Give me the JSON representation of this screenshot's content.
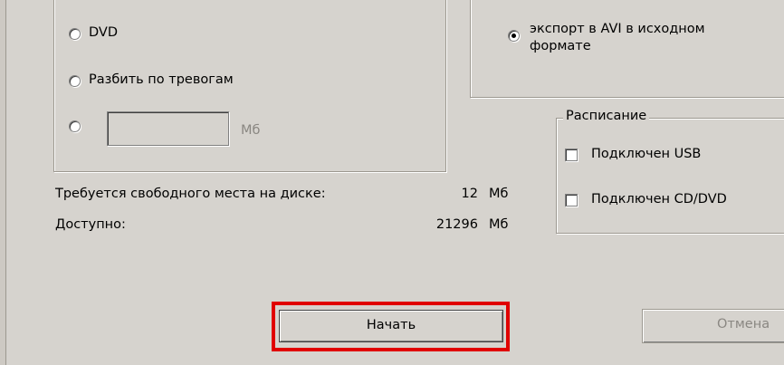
{
  "left_group": {
    "options": [
      {
        "label": "DVD",
        "selected": false
      },
      {
        "label": "Разбить по тревогам",
        "selected": false
      },
      {
        "label": "",
        "selected": false
      }
    ],
    "size_input_value": "",
    "size_unit": "Мб"
  },
  "export_group": {
    "option_label_line1": "экспорт в AVI в исходном",
    "option_label_line2": "формате",
    "selected": true
  },
  "schedule_group": {
    "legend": "Расписание",
    "checkboxes": [
      {
        "label": "Подключен USB",
        "checked": false
      },
      {
        "label": "Подключен CD/DVD",
        "checked": false
      }
    ]
  },
  "disk_info": {
    "required_label": "Требуется свободного места на диске:",
    "required_value": "12",
    "required_unit": "Мб",
    "available_label": "Доступно:",
    "available_value": "21296",
    "available_unit": "Мб"
  },
  "buttons": {
    "start_label": "Начать",
    "cancel_label": "Отмена"
  },
  "colors": {
    "highlight": "#e00000",
    "face": "#d6d3ce"
  }
}
